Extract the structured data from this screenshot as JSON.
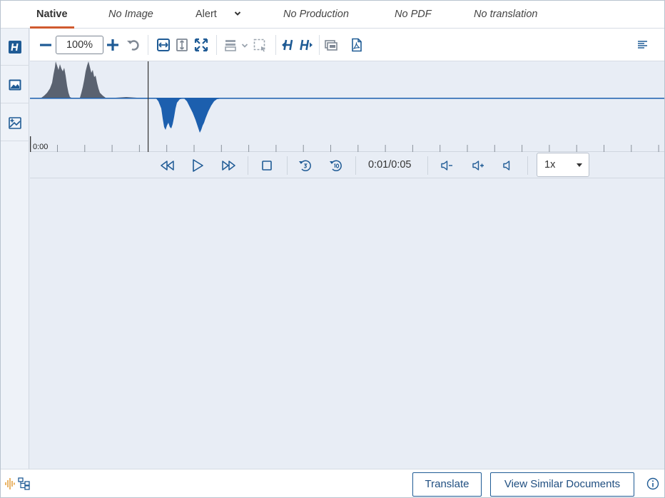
{
  "tabs": [
    {
      "label": "Native",
      "active": true
    },
    {
      "label": "No Image"
    },
    {
      "label": "Alert"
    },
    {
      "label": "No Production"
    },
    {
      "label": "No PDF"
    },
    {
      "label": "No translation"
    }
  ],
  "toolbar": {
    "zoom_value": "100%"
  },
  "waveform": {
    "start_time": "0:00"
  },
  "player": {
    "time_readout": "0:01/0:05",
    "speed_selected": "1x"
  },
  "footer": {
    "translate_label": "Translate",
    "similar_label": "View Similar Documents"
  },
  "colors": {
    "accent": "#1f5b95",
    "tab_underline": "#d05a2f",
    "waveform_played": "#5a6270",
    "waveform_unplayed": "#1c5fae",
    "footer_icon": "#e0962a"
  }
}
